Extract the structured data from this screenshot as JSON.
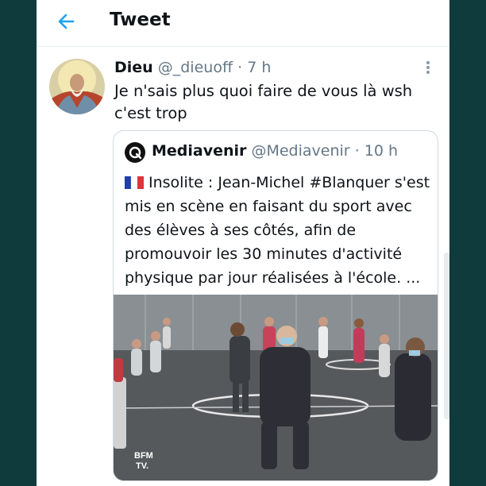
{
  "header": {
    "title": "Tweet",
    "back_icon": "arrow-left-icon"
  },
  "tweet": {
    "name": "Dieu",
    "handle": "@_dieuoff",
    "separator": "·",
    "time": "7 h",
    "text": "Je n'sais plus quoi faire de vous là wsh c'est trop",
    "avatar_icon": "avatar-image"
  },
  "quoted": {
    "name": "Mediavenir",
    "handle": "@Mediavenir",
    "separator": "·",
    "time": "10 h",
    "flag_icon": "france-flag-icon",
    "text": "Insolite : Jean-Michel #Blanquer s'est mis en scène en faisant du sport avec des élèves à ses côtés, afin de promouvoir les 30 minutes d'activité physique par jour réalisées à l'école. ...",
    "media": {
      "watermark_line1": "BFM",
      "watermark_line2": "TV."
    }
  },
  "colors": {
    "accent": "#1da1f2",
    "text": "#0f1419",
    "secondary": "#657786",
    "border": "#cfd9de",
    "background": "#0f3b3c"
  }
}
